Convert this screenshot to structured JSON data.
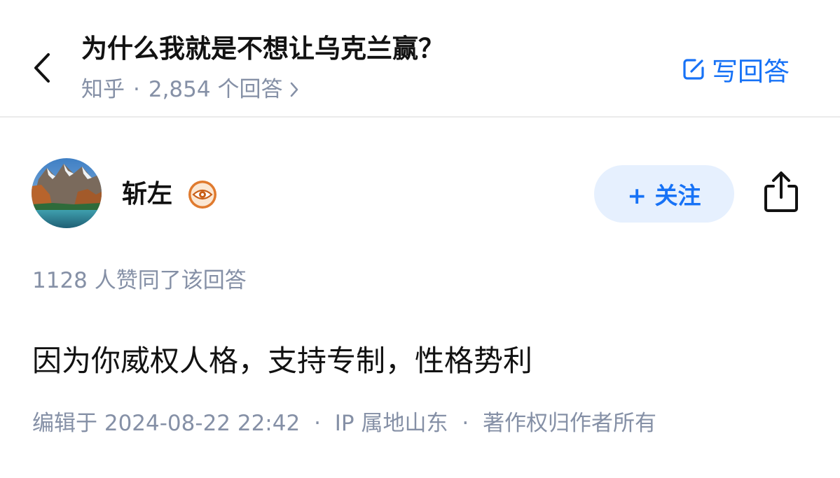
{
  "header": {
    "question_title": "为什么我就是不想让乌克兰赢？",
    "source": "知乎",
    "separator": "·",
    "answer_count": "2,854 个回答",
    "write_answer_label": "写回答"
  },
  "author": {
    "name": "斩左",
    "follow_label": "+ 关注"
  },
  "answer": {
    "votes_text": "1128 人赞同了该回答",
    "content": "因为你威权人格，支持专制，性格势利",
    "edited_text": "编辑于 2024-08-22 22:42",
    "ip_text": "IP 属地山东",
    "copyright_text": "著作权归作者所有",
    "separator": "·"
  },
  "icons": {
    "back": "chevron-left-icon",
    "answer_count_arrow": "chevron-right-icon",
    "write": "edit-icon",
    "badge": "eye-badge-icon",
    "share": "share-icon"
  },
  "colors": {
    "brand_blue": "#1772f6",
    "follow_bg": "#e6f0fe",
    "meta_gray": "#8590a6",
    "text": "#121212",
    "badge_orange": "#e07a2e"
  }
}
